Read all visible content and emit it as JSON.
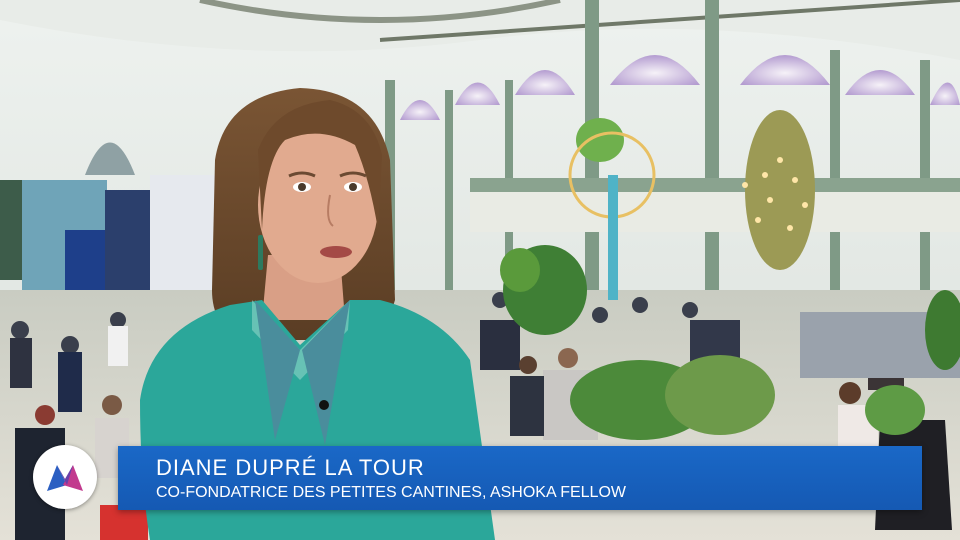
{
  "caption": {
    "name": "DIANE DUPRÉ LA TOUR",
    "role": "CO-FONDATRICE DES PETITES CANTINES, ASHOKA FELLOW"
  },
  "logo": {
    "icon": "m-logo-icon",
    "colors": [
      "#2b5fc2",
      "#c23a8e"
    ]
  },
  "colors": {
    "banner": "#1a68c7",
    "sweater": "#2aa69a"
  }
}
